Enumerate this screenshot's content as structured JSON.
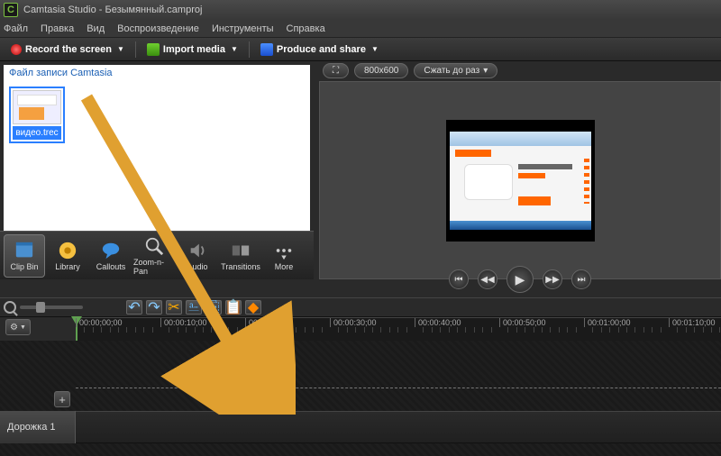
{
  "title": "Camtasia Studio - Безымянный.camproj",
  "logo_letter": "C",
  "menu": {
    "file": "Файл",
    "edit": "Правка",
    "view": "Вид",
    "play": "Воспроизведение",
    "tools": "Инструменты",
    "help": "Справка"
  },
  "toolbar": {
    "record": "Record the screen",
    "import": "Import media",
    "produce": "Produce and share"
  },
  "preview": {
    "dimensions": "800x600",
    "shrink": "Сжать до раз"
  },
  "clipbin": {
    "header": "Файл записи Camtasia",
    "thumb_name": "видео.trec"
  },
  "tabs": {
    "clipbin": "Clip Bin",
    "library": "Library",
    "callouts": "Callouts",
    "zoom": "Zoom-n-Pan",
    "audio": "Audio",
    "transitions": "Transitions",
    "more": "More"
  },
  "timeline": {
    "ticks": [
      "00:00;00;00",
      "00:00:10;00",
      "00:00:20;00",
      "00:00:30;00",
      "00:00:40;00",
      "00:00:50;00",
      "00:01:00;00",
      "00:01:10;00"
    ],
    "track1": "Дорожка 1"
  }
}
